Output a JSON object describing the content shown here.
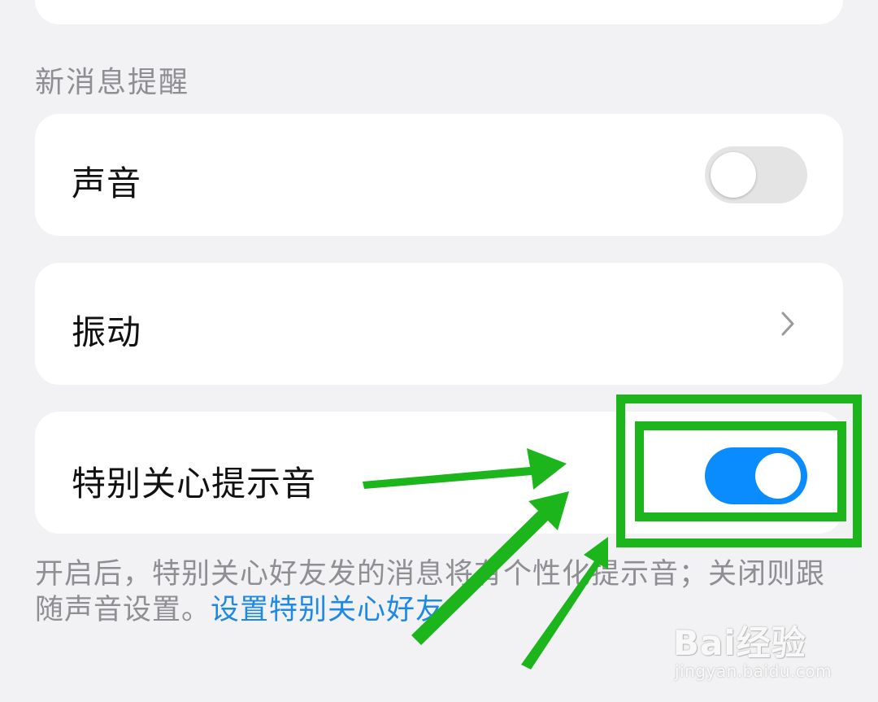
{
  "section": {
    "title": "新消息提醒"
  },
  "settings": {
    "sound": {
      "label": "声音",
      "enabled": false
    },
    "vibration": {
      "label": "振动",
      "icon": "chevron-right-icon"
    },
    "special_care_tone": {
      "label": "特别关心提示音",
      "enabled": true
    }
  },
  "description": {
    "text": "开启后，特别关心好友发的消息将有个性化提示音；关闭则跟随声音设置。",
    "link": "设置特别关心好友"
  },
  "watermark": {
    "brand": "Bai经验",
    "url": "jingyan.baidu.com"
  },
  "colors": {
    "toggle_on": "#0a8cff",
    "toggle_off": "#e4e4e4",
    "annotation": "#1cb51c",
    "link": "#1e88e5"
  }
}
